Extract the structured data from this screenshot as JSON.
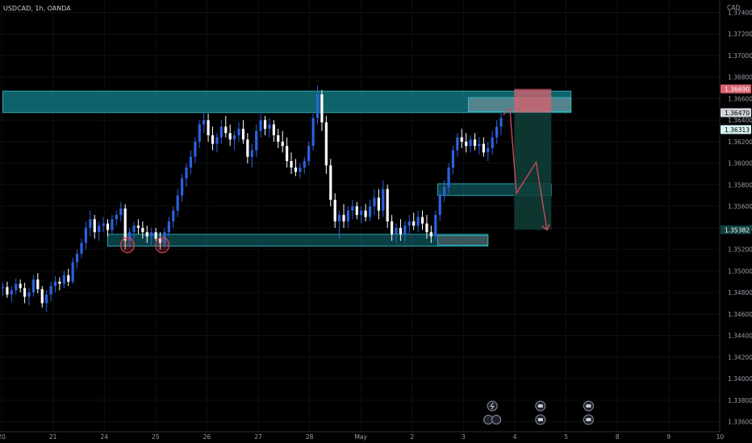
{
  "header": {
    "symbol": "USDCAD, 1h, OANDA",
    "currency": "CAD"
  },
  "colors": {
    "background": "#000000",
    "candle_up": "#2a62e0",
    "candle_down": "#ffffff",
    "zone_teal": "#13737c",
    "zone_border": "#32c0cc",
    "target_zone": "#0f3f3a",
    "stop_zone": "#d9606e",
    "projection": "#c94a5a",
    "marker_circle": "#d04050"
  },
  "chart_data": {
    "type": "candlestick",
    "ylim": [
      1.3355,
      1.3745
    ],
    "y_ticks": [
      "1.37400",
      "1.37200",
      "1.37000",
      "1.36800",
      "1.36600",
      "1.36400",
      "1.36200",
      "1.36000",
      "1.35800",
      "1.35600",
      "1.35400",
      "1.35200",
      "1.35000",
      "1.34800",
      "1.34600",
      "1.34400",
      "1.34200",
      "1.34000",
      "1.33800",
      "1.33600"
    ],
    "x_ticks": [
      "20",
      "21",
      "24",
      "25",
      "26",
      "27",
      "28",
      "May",
      "2",
      "3",
      "4",
      "5",
      "8",
      "9",
      "10"
    ],
    "price_tags": [
      {
        "label": "1.36690",
        "value": 1.3669,
        "style": "stop"
      },
      {
        "label": "1.36470",
        "value": 1.3647,
        "style": "current"
      },
      {
        "label": "1.36313",
        "value": 1.36313,
        "style": "level"
      },
      {
        "label": "1.35382",
        "value": 1.35382,
        "style": "target"
      }
    ],
    "zones": [
      {
        "name": "resistance",
        "from_x": 0,
        "to_x": 130,
        "y_low": 1.3647,
        "y_high": 1.3667
      },
      {
        "name": "resistance-retest",
        "from_x": 106.5,
        "to_x": 130,
        "y_low": 1.3648,
        "y_high": 1.3661
      },
      {
        "name": "support",
        "from_x": 24,
        "to_x": 111,
        "y_low": 1.3523,
        "y_high": 1.3534
      },
      {
        "name": "support-retest",
        "from_x": 99.5,
        "to_x": 111,
        "y_low": 1.3524,
        "y_high": 1.3533
      },
      {
        "name": "mid-support",
        "from_x": 99.5,
        "to_x": 125.5,
        "y_low": 1.357,
        "y_high": 1.3581
      }
    ],
    "position": {
      "from_x": 117,
      "to_x": 125.5,
      "entry": 1.3647,
      "stop": 1.3669,
      "target": 1.35382
    },
    "projection_path": [
      [
        114.5,
        1.3645
      ],
      [
        116,
        1.3651
      ],
      [
        117.5,
        1.3572
      ],
      [
        122,
        1.3601
      ],
      [
        124.5,
        1.3538
      ]
    ],
    "marker_circles": [
      [
        28.5,
        1.3524
      ],
      [
        36.5,
        1.3524
      ]
    ],
    "events": [
      [
        112,
        "lightning"
      ],
      [
        112,
        "flags"
      ],
      [
        123,
        "flag"
      ],
      [
        123,
        "flag"
      ],
      [
        134,
        "flag"
      ],
      [
        134,
        "flag"
      ]
    ],
    "candles": [
      [
        0,
        1.3484,
        1.3489,
        1.3477,
        1.3485
      ],
      [
        1,
        1.3485,
        1.349,
        1.3475,
        1.3478
      ],
      [
        2,
        1.3478,
        1.3486,
        1.3471,
        1.3482
      ],
      [
        3,
        1.3482,
        1.3493,
        1.3478,
        1.3488
      ],
      [
        4,
        1.3488,
        1.3492,
        1.348,
        1.3484
      ],
      [
        5,
        1.3484,
        1.3489,
        1.347,
        1.3476
      ],
      [
        6,
        1.3476,
        1.3484,
        1.3468,
        1.348
      ],
      [
        7,
        1.348,
        1.3496,
        1.3476,
        1.3492
      ],
      [
        8,
        1.3492,
        1.3498,
        1.3479,
        1.3483
      ],
      [
        9,
        1.3483,
        1.3486,
        1.3466,
        1.347
      ],
      [
        10,
        1.347,
        1.3482,
        1.3462,
        1.3478
      ],
      [
        11,
        1.3478,
        1.349,
        1.3472,
        1.3486
      ],
      [
        12,
        1.3486,
        1.3495,
        1.348,
        1.349
      ],
      [
        13,
        1.349,
        1.3494,
        1.3482,
        1.3488
      ],
      [
        14,
        1.3488,
        1.35,
        1.3484,
        1.3496
      ],
      [
        15,
        1.3496,
        1.3502,
        1.3486,
        1.349
      ],
      [
        16,
        1.349,
        1.3512,
        1.3488,
        1.3508
      ],
      [
        17,
        1.3508,
        1.352,
        1.3502,
        1.3516
      ],
      [
        18,
        1.3516,
        1.353,
        1.3512,
        1.3526
      ],
      [
        19,
        1.3526,
        1.3546,
        1.352,
        1.354
      ],
      [
        20,
        1.354,
        1.3556,
        1.3532,
        1.3548
      ],
      [
        21,
        1.3548,
        1.3552,
        1.353,
        1.3536
      ],
      [
        22,
        1.3536,
        1.3546,
        1.3528,
        1.3542
      ],
      [
        23,
        1.3542,
        1.355,
        1.3536,
        1.3544
      ],
      [
        24,
        1.3544,
        1.3548,
        1.3532,
        1.3538
      ],
      [
        25,
        1.3538,
        1.3552,
        1.3534,
        1.3548
      ],
      [
        26,
        1.3548,
        1.3556,
        1.3542,
        1.3552
      ],
      [
        27,
        1.3552,
        1.3564,
        1.3546,
        1.3558
      ],
      [
        28,
        1.3558,
        1.3562,
        1.352,
        1.3528
      ],
      [
        29,
        1.3528,
        1.354,
        1.3522,
        1.3536
      ],
      [
        30,
        1.3536,
        1.3546,
        1.353,
        1.3542
      ],
      [
        31,
        1.3542,
        1.3548,
        1.3534,
        1.354
      ],
      [
        32,
        1.354,
        1.3546,
        1.353,
        1.3536
      ],
      [
        33,
        1.3536,
        1.3542,
        1.3526,
        1.3532
      ],
      [
        34,
        1.3532,
        1.354,
        1.3524,
        1.3536
      ],
      [
        35,
        1.3536,
        1.354,
        1.3528,
        1.353
      ],
      [
        36,
        1.353,
        1.3536,
        1.352,
        1.3526
      ],
      [
        37,
        1.3526,
        1.354,
        1.3522,
        1.3536
      ],
      [
        38,
        1.3536,
        1.355,
        1.3532,
        1.3546
      ],
      [
        39,
        1.3546,
        1.356,
        1.354,
        1.3556
      ],
      [
        40,
        1.3556,
        1.3576,
        1.355,
        1.357
      ],
      [
        41,
        1.357,
        1.359,
        1.3564,
        1.3586
      ],
      [
        42,
        1.3586,
        1.36,
        1.3578,
        1.3596
      ],
      [
        43,
        1.3596,
        1.3612,
        1.359,
        1.3606
      ],
      [
        44,
        1.3606,
        1.3624,
        1.36,
        1.362
      ],
      [
        45,
        1.362,
        1.364,
        1.3614,
        1.3636
      ],
      [
        46,
        1.3636,
        1.3648,
        1.3628,
        1.364
      ],
      [
        47,
        1.364,
        1.3646,
        1.362,
        1.3626
      ],
      [
        48,
        1.3626,
        1.3634,
        1.3612,
        1.3618
      ],
      [
        49,
        1.3618,
        1.3628,
        1.361,
        1.3624
      ],
      [
        50,
        1.3624,
        1.364,
        1.3618,
        1.3634
      ],
      [
        51,
        1.3634,
        1.3644,
        1.3624,
        1.3628
      ],
      [
        52,
        1.3628,
        1.3636,
        1.3616,
        1.3622
      ],
      [
        53,
        1.3622,
        1.363,
        1.3612,
        1.3626
      ],
      [
        54,
        1.3626,
        1.3638,
        1.362,
        1.3632
      ],
      [
        55,
        1.3632,
        1.364,
        1.3618,
        1.3622
      ],
      [
        56,
        1.3622,
        1.3628,
        1.36,
        1.3606
      ],
      [
        57,
        1.3606,
        1.3618,
        1.3596,
        1.3612
      ],
      [
        58,
        1.3612,
        1.3636,
        1.3606,
        1.363
      ],
      [
        59,
        1.363,
        1.3646,
        1.3624,
        1.364
      ],
      [
        60,
        1.364,
        1.3644,
        1.3626,
        1.3632
      ],
      [
        61,
        1.3632,
        1.3642,
        1.3624,
        1.3636
      ],
      [
        62,
        1.3636,
        1.364,
        1.362,
        1.3626
      ],
      [
        63,
        1.3626,
        1.3632,
        1.3614,
        1.362
      ],
      [
        64,
        1.362,
        1.363,
        1.361,
        1.3616
      ],
      [
        65,
        1.3616,
        1.3624,
        1.3596,
        1.3602
      ],
      [
        66,
        1.3602,
        1.361,
        1.359,
        1.3596
      ],
      [
        67,
        1.3596,
        1.3604,
        1.3588,
        1.3592
      ],
      [
        68,
        1.3592,
        1.36,
        1.3586,
        1.3596
      ],
      [
        69,
        1.3596,
        1.3606,
        1.359,
        1.3602
      ],
      [
        70,
        1.3602,
        1.362,
        1.3598,
        1.3616
      ],
      [
        71,
        1.3616,
        1.3646,
        1.3612,
        1.3642
      ],
      [
        72,
        1.3642,
        1.3672,
        1.3636,
        1.3664
      ],
      [
        73,
        1.3664,
        1.3668,
        1.363,
        1.3638
      ],
      [
        74,
        1.3638,
        1.3644,
        1.359,
        1.3598
      ],
      [
        75,
        1.3598,
        1.3604,
        1.356,
        1.3566
      ],
      [
        76,
        1.3566,
        1.3572,
        1.354,
        1.3546
      ],
      [
        77,
        1.3546,
        1.3556,
        1.353,
        1.3552
      ],
      [
        78,
        1.3552,
        1.3562,
        1.354,
        1.3546
      ],
      [
        79,
        1.3546,
        1.356,
        1.354,
        1.3556
      ],
      [
        80,
        1.3556,
        1.3566,
        1.3548,
        1.356
      ],
      [
        81,
        1.356,
        1.3564,
        1.3548,
        1.3552
      ],
      [
        82,
        1.3552,
        1.356,
        1.3544,
        1.3556
      ],
      [
        83,
        1.3556,
        1.3562,
        1.3546,
        1.355
      ],
      [
        84,
        1.355,
        1.3566,
        1.3546,
        1.356
      ],
      [
        85,
        1.356,
        1.3576,
        1.3552,
        1.3568
      ],
      [
        86,
        1.3568,
        1.3576,
        1.3548,
        1.3556
      ],
      [
        87,
        1.3556,
        1.3584,
        1.355,
        1.3576
      ],
      [
        88,
        1.3576,
        1.358,
        1.354,
        1.3546
      ],
      [
        89,
        1.3546,
        1.3552,
        1.3528,
        1.3534
      ],
      [
        90,
        1.3534,
        1.3544,
        1.3526,
        1.354
      ],
      [
        91,
        1.354,
        1.3548,
        1.3528,
        1.3534
      ],
      [
        92,
        1.3534,
        1.3546,
        1.3526,
        1.3542
      ],
      [
        93,
        1.3542,
        1.3552,
        1.3534,
        1.3546
      ],
      [
        94,
        1.3546,
        1.3554,
        1.3538,
        1.3542
      ],
      [
        95,
        1.3542,
        1.3556,
        1.3536,
        1.355
      ],
      [
        96,
        1.355,
        1.3556,
        1.3538,
        1.3544
      ],
      [
        97,
        1.3544,
        1.3552,
        1.353,
        1.3536
      ],
      [
        98,
        1.3536,
        1.3542,
        1.3526,
        1.3532
      ],
      [
        99,
        1.3532,
        1.3556,
        1.3528,
        1.3552
      ],
      [
        100,
        1.3552,
        1.3574,
        1.3546,
        1.357
      ],
      [
        101,
        1.357,
        1.3584,
        1.3564,
        1.3578
      ],
      [
        102,
        1.3578,
        1.36,
        1.3572,
        1.3596
      ],
      [
        103,
        1.3596,
        1.3616,
        1.359,
        1.3612
      ],
      [
        104,
        1.3612,
        1.3628,
        1.3606,
        1.3624
      ],
      [
        105,
        1.3624,
        1.3632,
        1.3614,
        1.362
      ],
      [
        106,
        1.362,
        1.3628,
        1.361,
        1.3616
      ],
      [
        107,
        1.3616,
        1.3626,
        1.361,
        1.3622
      ],
      [
        108,
        1.3622,
        1.3628,
        1.3612,
        1.3616
      ],
      [
        109,
        1.3616,
        1.3624,
        1.3608,
        1.3618
      ],
      [
        110,
        1.3618,
        1.3624,
        1.3606,
        1.361
      ],
      [
        111,
        1.361,
        1.362,
        1.3602,
        1.3614
      ],
      [
        112,
        1.3614,
        1.363,
        1.3608,
        1.3624
      ],
      [
        113,
        1.3624,
        1.364,
        1.3618,
        1.3634
      ],
      [
        114,
        1.3634,
        1.3646,
        1.3626,
        1.3642
      ]
    ]
  }
}
